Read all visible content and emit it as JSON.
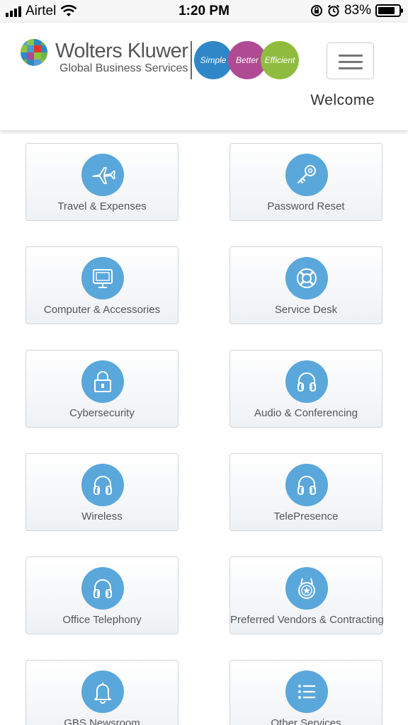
{
  "status_bar": {
    "carrier": "Airtel",
    "time": "1:20 PM",
    "battery": "83%",
    "battery_level": 0.83
  },
  "header": {
    "brand_name": "Wolters Kluwer",
    "brand_sub": "Global Business Services",
    "tagline": [
      "Simple",
      "Better",
      "Efficient"
    ],
    "welcome": "Welcome",
    "colors": {
      "blue": "#2f87c8",
      "magenta": "#b04a93",
      "green": "#8fbc3f"
    }
  },
  "accent_color": "#5aa7dc",
  "tiles": [
    {
      "label": "Travel & Expenses",
      "icon": "airplane-icon"
    },
    {
      "label": "Password Reset",
      "icon": "key-icon"
    },
    {
      "label": "Computer & Accessories",
      "icon": "monitor-icon"
    },
    {
      "label": "Service Desk",
      "icon": "lifebuoy-icon"
    },
    {
      "label": "Cybersecurity",
      "icon": "lock-icon"
    },
    {
      "label": "Audio & Conferencing",
      "icon": "headphones-icon"
    },
    {
      "label": "Wireless",
      "icon": "headphones-icon"
    },
    {
      "label": "TelePresence",
      "icon": "headphones-icon"
    },
    {
      "label": "Office Telephony",
      "icon": "headphones-icon"
    },
    {
      "label": "Preferred Vendors & Contracting",
      "icon": "badge-icon"
    },
    {
      "label": "GBS Newsroom",
      "icon": "bell-icon"
    },
    {
      "label": "Other Services",
      "icon": "list-icon"
    }
  ]
}
